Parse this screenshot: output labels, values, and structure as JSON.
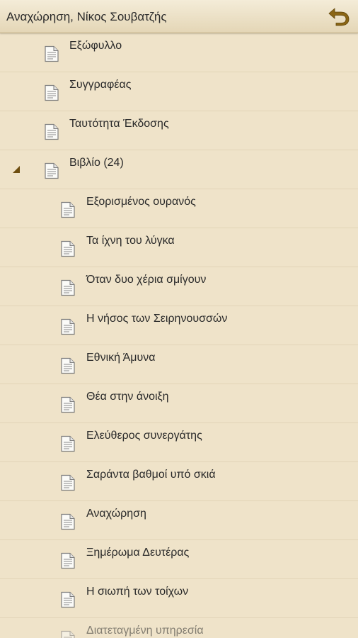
{
  "header": {
    "title": "Αναχώρηση, Νίκος Σουβατζής",
    "back_icon": "back-arrow-icon"
  },
  "colors": {
    "background": "#efe3c9",
    "accent": "#8a6514",
    "divider": "#e2d4b7"
  },
  "toc": {
    "items": [
      {
        "label": "Εξώφυλλο",
        "level": 0
      },
      {
        "label": "Συγγραφέας",
        "level": 0
      },
      {
        "label": "Ταυτότητα Έκδοσης",
        "level": 0
      },
      {
        "label": "Βιβλίο (24)",
        "level": 0,
        "expanded": true
      },
      {
        "label": "Εξορισμένος ουρανός",
        "level": 1
      },
      {
        "label": "Τα ίχνη του λύγκα",
        "level": 1
      },
      {
        "label": "Όταν δυο χέρια σμίγουν",
        "level": 1
      },
      {
        "label": "Η νήσος των Σειρηνουσσών",
        "level": 1
      },
      {
        "label": "Εθνική Άμυνα",
        "level": 1
      },
      {
        "label": "Θέα στην άνοιξη",
        "level": 1
      },
      {
        "label": "Ελεύθερος συνεργάτης",
        "level": 1
      },
      {
        "label": "Σαράντα βαθμοί υπό σκιά",
        "level": 1
      },
      {
        "label": "Αναχώρηση",
        "level": 1
      },
      {
        "label": "Ξημέρωμα Δευτέρας",
        "level": 1
      },
      {
        "label": "Η σιωπή των τοίχων",
        "level": 1
      },
      {
        "label": "Διατεταγμένη υπηρεσία",
        "level": 1
      }
    ]
  }
}
